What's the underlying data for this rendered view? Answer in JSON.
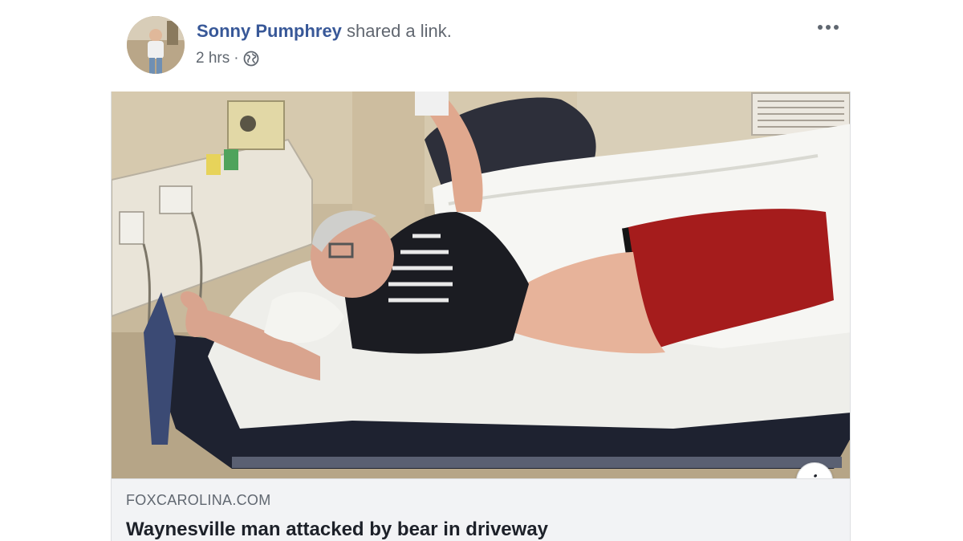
{
  "post": {
    "author": "Sonny Pumphrey",
    "action": "shared a link.",
    "timestamp": "2 hrs",
    "separator": "·",
    "privacy_icon": "globe-icon",
    "menu_icon": "more-options-icon"
  },
  "link_card": {
    "image_description_icon": "hospital-photo",
    "info_label": "i",
    "source": "FOXCAROLINA.COM",
    "title": "Waynesville man attacked by bear in driveway"
  },
  "colors": {
    "author_link": "#385898",
    "secondary_text": "#606770",
    "caption_background": "#f2f3f5",
    "title_text": "#1d2129"
  }
}
